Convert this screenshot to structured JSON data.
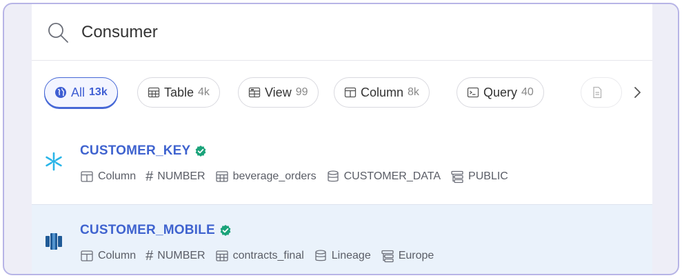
{
  "search": {
    "value": "Consumer"
  },
  "filters": [
    {
      "label": "All",
      "count": "13k",
      "icon": "globe-icon",
      "active": true
    },
    {
      "label": "Table",
      "count": "4k",
      "icon": "table-icon"
    },
    {
      "label": "View",
      "count": "99",
      "icon": "view-icon"
    },
    {
      "label": "Column",
      "count": "8k",
      "icon": "column-icon"
    },
    {
      "label": "Query",
      "count": "40",
      "icon": "query-icon"
    }
  ],
  "results": [
    {
      "title": "CUSTOMER_KEY",
      "source_icon": "snowflake-icon",
      "verified": true,
      "meta": {
        "type": "Column",
        "datatype": "NUMBER",
        "table": "beverage_orders",
        "database": "CUSTOMER_DATA",
        "schema": "PUBLIC"
      }
    },
    {
      "title": "CUSTOMER_MOBILE",
      "source_icon": "redshift-icon",
      "verified": true,
      "meta": {
        "type": "Column",
        "datatype": "NUMBER",
        "table": "contracts_final",
        "database": "Lineage",
        "schema": "Europe"
      }
    }
  ],
  "colors": {
    "accent": "#3f63cf",
    "verified": "#1aa37a",
    "selected_row": "#eaf2fb",
    "frame_border": "#b7b4e6"
  }
}
